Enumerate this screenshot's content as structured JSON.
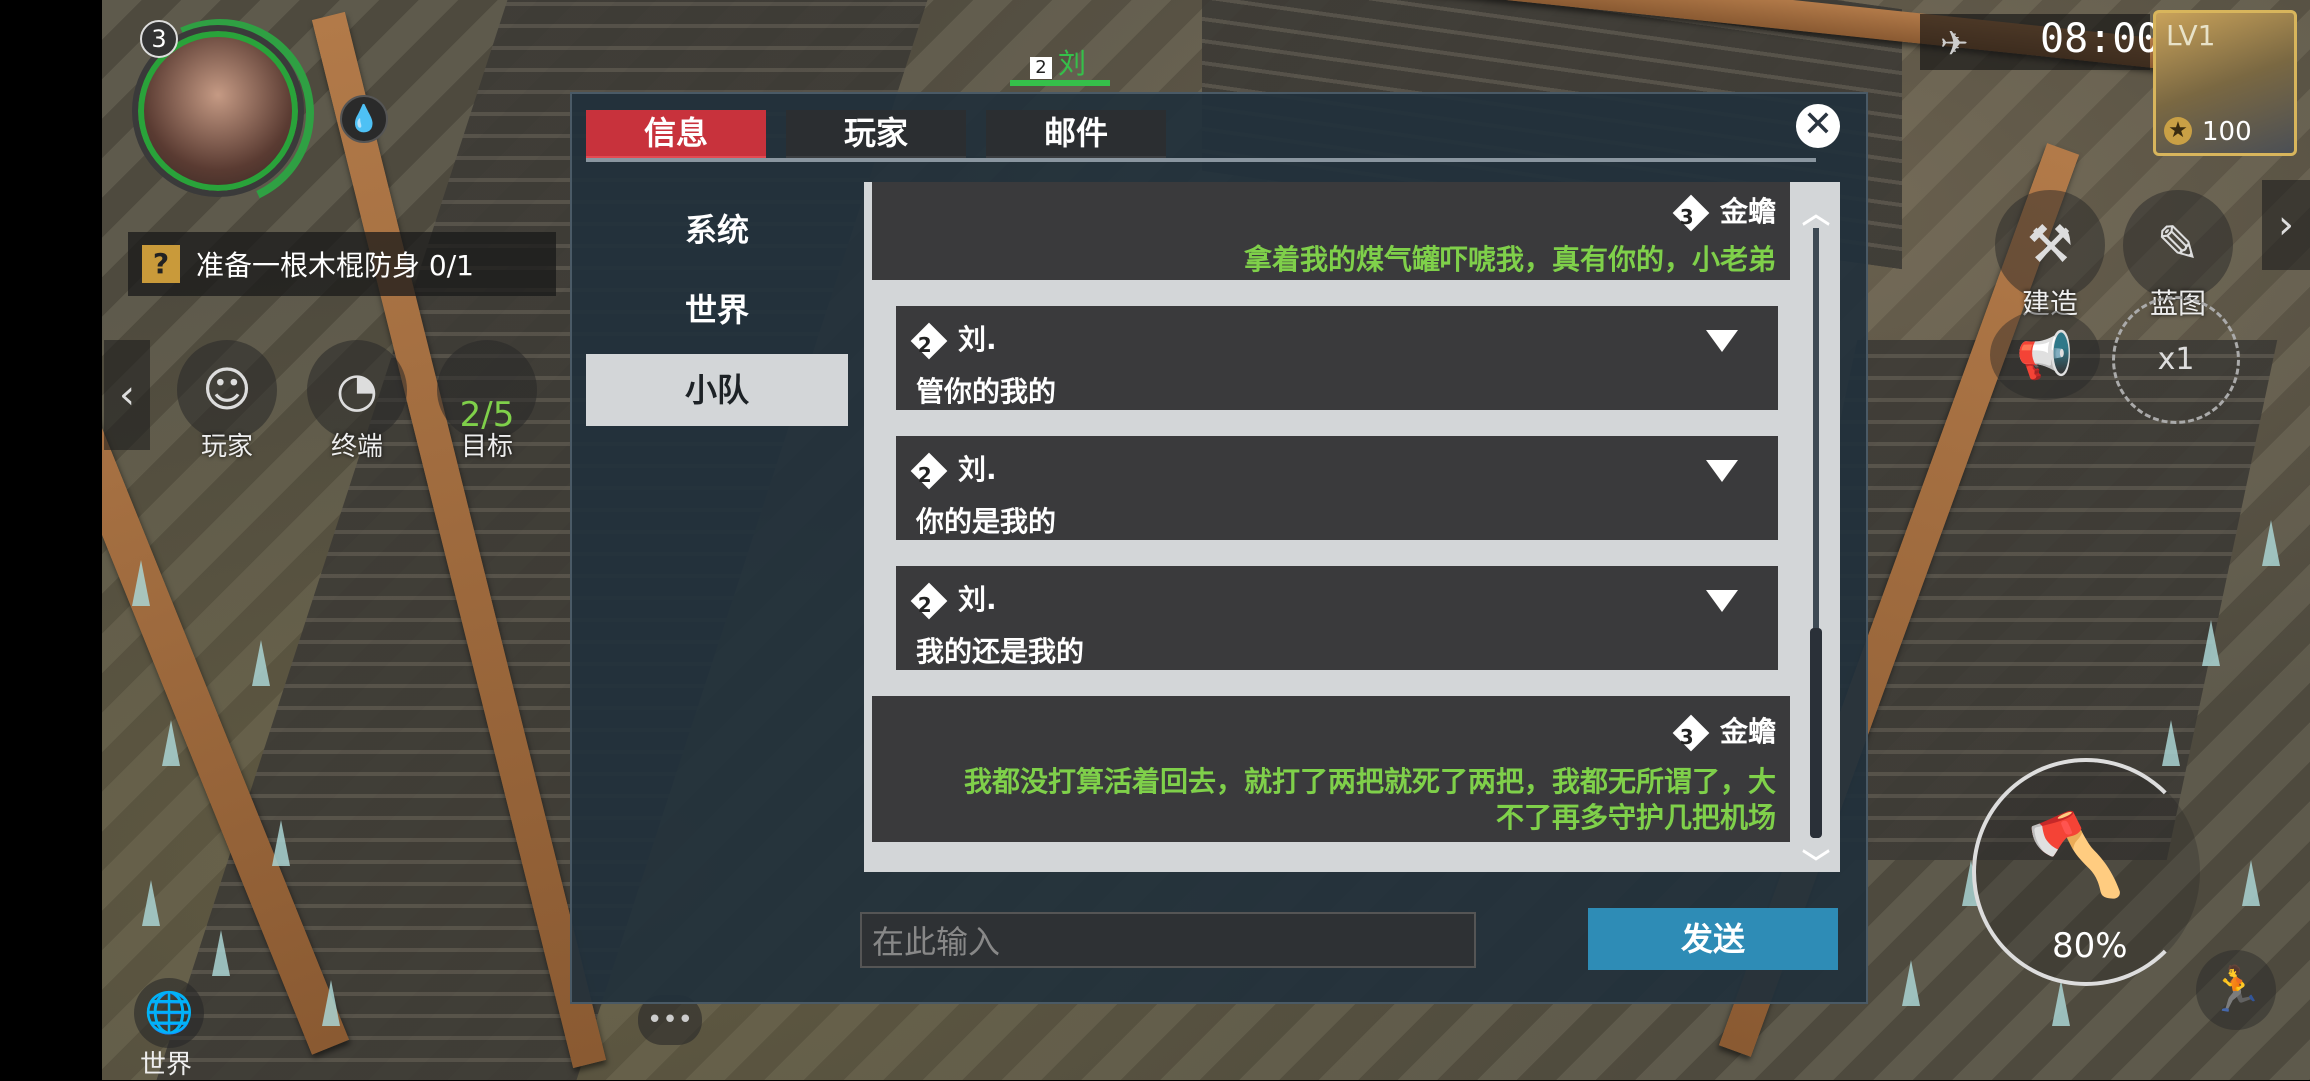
{
  "hud": {
    "player_level": "3",
    "quest_marker": "?",
    "quest_text": "准备一根木棍防身 0/1",
    "buttons": [
      {
        "label": "玩家"
      },
      {
        "label": "终端"
      },
      {
        "label": "目标",
        "progress": "2/5"
      }
    ],
    "clock": "08:00",
    "chest_level": "LV1",
    "chest_count": "100",
    "build_label": "建造",
    "blueprint_label": "蓝图",
    "multiplier": "x1",
    "weapon_durability": "80%",
    "world_label": "世界",
    "overhead_name": "刘",
    "overhead_level": "2"
  },
  "dialog": {
    "tabs": [
      "信息",
      "玩家",
      "邮件"
    ],
    "active_tab": 0,
    "channels": [
      "系统",
      "世界",
      "小队"
    ],
    "active_channel": 2,
    "messages": [
      {
        "level": "3",
        "name": "金蟾",
        "text": "拿着我的煤气罐吓唬我，真有你的，小老弟",
        "side": "right"
      },
      {
        "level": "2",
        "name": "刘.",
        "text": "管你的我的",
        "side": "left"
      },
      {
        "level": "2",
        "name": "刘.",
        "text": "你的是我的",
        "side": "left"
      },
      {
        "level": "2",
        "name": "刘.",
        "text": "我的还是我的",
        "side": "left"
      },
      {
        "level": "3",
        "name": "金蟾",
        "text_line1": "我都没打算活着回去，就打了两把就死了两把，我都无所谓了，大",
        "text_line2": "不了再多守护几把机场",
        "side": "right"
      }
    ],
    "input_placeholder": "在此输入",
    "send_label": "发送",
    "close_icon": "close-icon"
  },
  "colors": {
    "active_tab": "#c8323c",
    "self_text": "#7fd04a",
    "send_button": "#2e8cb6",
    "health_ring": "#2fa043"
  }
}
